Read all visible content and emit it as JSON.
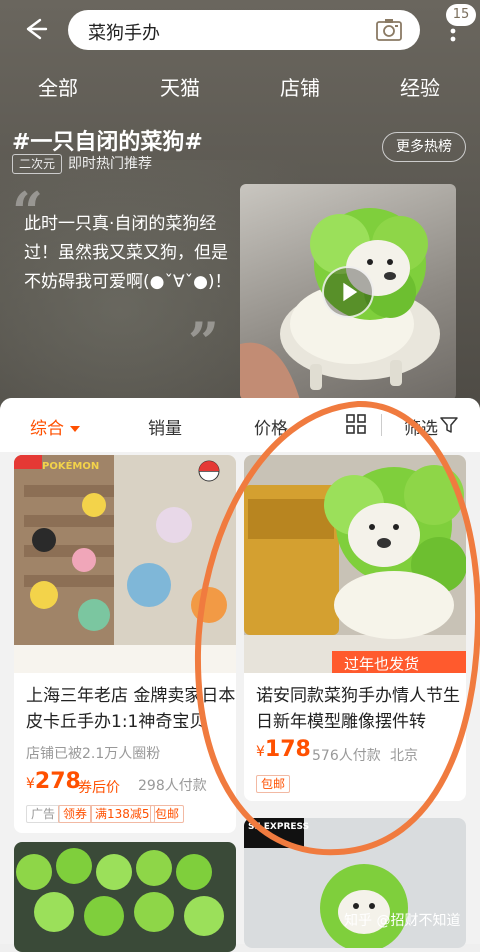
{
  "search": {
    "query": "菜狗手办",
    "badge_count": "15"
  },
  "tabs": [
    "全部",
    "天猫",
    "店铺",
    "经验"
  ],
  "topic": {
    "title": "#一只自闭的菜狗#",
    "chip": "二次元",
    "subtitle": "即时热门推荐",
    "more_button": "更多热榜",
    "quote_open": "“",
    "quote_close": "”",
    "description": "此时一只真·自闭的菜狗经过！虽然我又菜又狗，但是不妨碍我可爱啊(●ˇ∀ˇ●)！"
  },
  "sort_bar": {
    "comprehensive": "综合",
    "sales": "销量",
    "price": "价格",
    "filter": "筛选"
  },
  "products": [
    {
      "title": "上海三年老店 金牌卖家日本皮卡丘手办1:1神奇宝贝",
      "fans": "店铺已被2.1万人圈粉",
      "price_symbol": "¥",
      "price": "278",
      "price_note": "券后价",
      "buyers": "298人付款",
      "tags": [
        "广告",
        "领券",
        "满138减5",
        "包邮"
      ],
      "img_label": "POKÉMON"
    },
    {
      "title": "诺安同款菜狗手办情人节生日新年模型雕像摆件转",
      "price_symbol": "¥",
      "price": "178",
      "buyers": "576人付款",
      "location": "北京",
      "tags": [
        "包邮"
      ],
      "img_banner": "过年也发货"
    }
  ],
  "bottom_card_label": "SF EXPRESS",
  "watermark": "知乎 @招财不知道",
  "colors": {
    "accent": "#ff5000",
    "annotation": "#f07b3f"
  }
}
